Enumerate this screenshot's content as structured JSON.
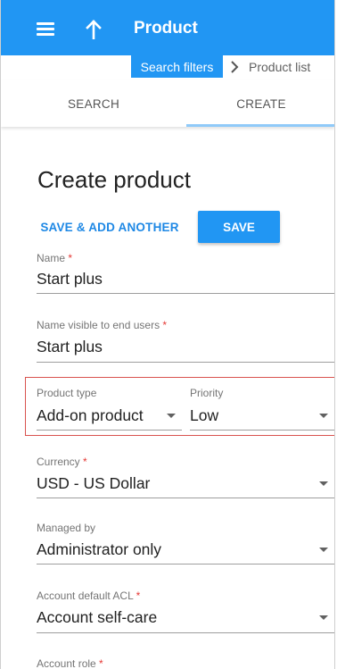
{
  "appbar": {
    "title": "Product",
    "menu_icon": "menu-icon",
    "up_icon": "arrow-up-icon",
    "color": "#2196f3"
  },
  "breadcrumb": {
    "filters_label": "Search filters",
    "list_label": "Product list",
    "separator_icon": "chevron-right-icon"
  },
  "tabs": [
    {
      "label": "SEARCH",
      "active": false
    },
    {
      "label": "CREATE",
      "active": true
    }
  ],
  "page": {
    "title": "Create product"
  },
  "actions": {
    "save_add_another_label": "SAVE & ADD ANOTHER",
    "save_label": "SAVE"
  },
  "form": {
    "name": {
      "label": "Name",
      "required_mark": "*",
      "value": "Start plus"
    },
    "visible_name": {
      "label": "Name visible to end users",
      "required_mark": "*",
      "value": "Start plus"
    },
    "product_type": {
      "label": "Product type",
      "value": "Add-on product"
    },
    "priority": {
      "label": "Priority",
      "value": "Low"
    },
    "currency": {
      "label": "Currency",
      "required_mark": "*",
      "value": "USD - US Dollar"
    },
    "managed_by": {
      "label": "Managed by",
      "value": "Administrator only"
    },
    "account_default_acl": {
      "label": "Account default ACL",
      "required_mark": "*",
      "value": "Account self-care"
    },
    "account_role": {
      "label": "Account role",
      "required_mark": "*"
    }
  },
  "colors": {
    "accent": "#2196f3",
    "required": "#e53935",
    "highlight": "#d9534f"
  }
}
